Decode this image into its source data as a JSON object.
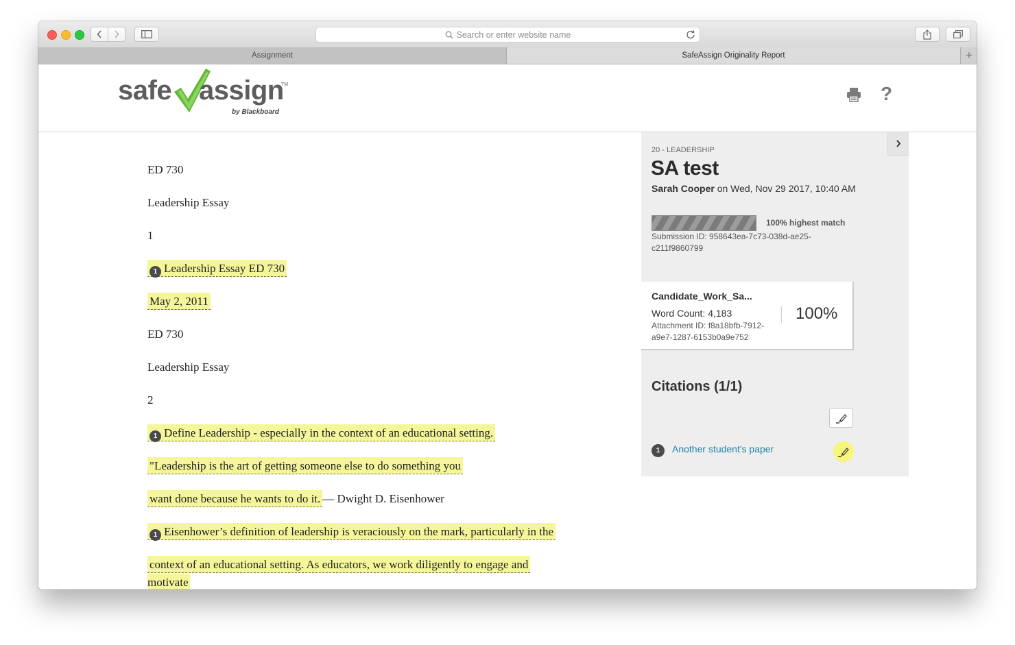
{
  "browser": {
    "search_placeholder": "Search or enter website name",
    "tabs": [
      {
        "label": "Assignment"
      },
      {
        "label": "SafeAssign Originality Report"
      }
    ],
    "new_tab_label": "+"
  },
  "header": {
    "logo_safe": "safe",
    "logo_assign": "assign",
    "logo_tm": "TM",
    "logo_byline": "by Blackboard",
    "help_label": "?"
  },
  "document": {
    "paragraphs": [
      {
        "text": "ED 730"
      },
      {
        "text": "Leadership Essay"
      },
      {
        "text": "1"
      },
      {
        "pin": "1",
        "text": "Leadership Essay ED 730"
      },
      {
        "text": "May 2, 2011"
      },
      {
        "text": "ED 730"
      },
      {
        "text": "Leadership Essay"
      },
      {
        "text": "2"
      },
      {
        "pin": "1",
        "text": "Define Leadership - especially in the context of an educational setting."
      },
      {
        "text": "\"Leadership is the art of getting someone else to do something you"
      },
      {
        "text": "want done because he wants to do it.",
        "tail": "— Dwight D. Eisenhower"
      },
      {
        "pin": "1",
        "text": "Eisenhower’s definition of leadership is veraciously on the mark, particularly in the"
      },
      {
        "text": "context of an educational setting.  As educators, we work diligently to engage and"
      },
      {
        "text": "motivate"
      }
    ]
  },
  "panel": {
    "label": "20 - LEADERSHIP",
    "title": "SA test",
    "author": "Sarah Cooper",
    "date_line": " on Wed, Nov 29 2017, 10:40 AM",
    "match_fraction": 1.0,
    "match_label": "100% highest match",
    "submission_id": "Submission ID: 958643ea-7c73-038d-ae25-c211f9860799",
    "card": {
      "name": "Candidate_Work_Sa...",
      "word_count": "Word Count: 4,183",
      "attachment_id": "Attachment ID: f8a18bfb-7912-a9e7-1287-6153b0a9e752",
      "percent": "100%"
    },
    "citations_title": "Citations (1/1)",
    "citations": [
      {
        "number": "1",
        "label": "Another student's paper"
      }
    ]
  },
  "colors": {
    "highlight": "#f5f69a",
    "logo_check": "#5fb834",
    "link": "#1d85a8"
  }
}
